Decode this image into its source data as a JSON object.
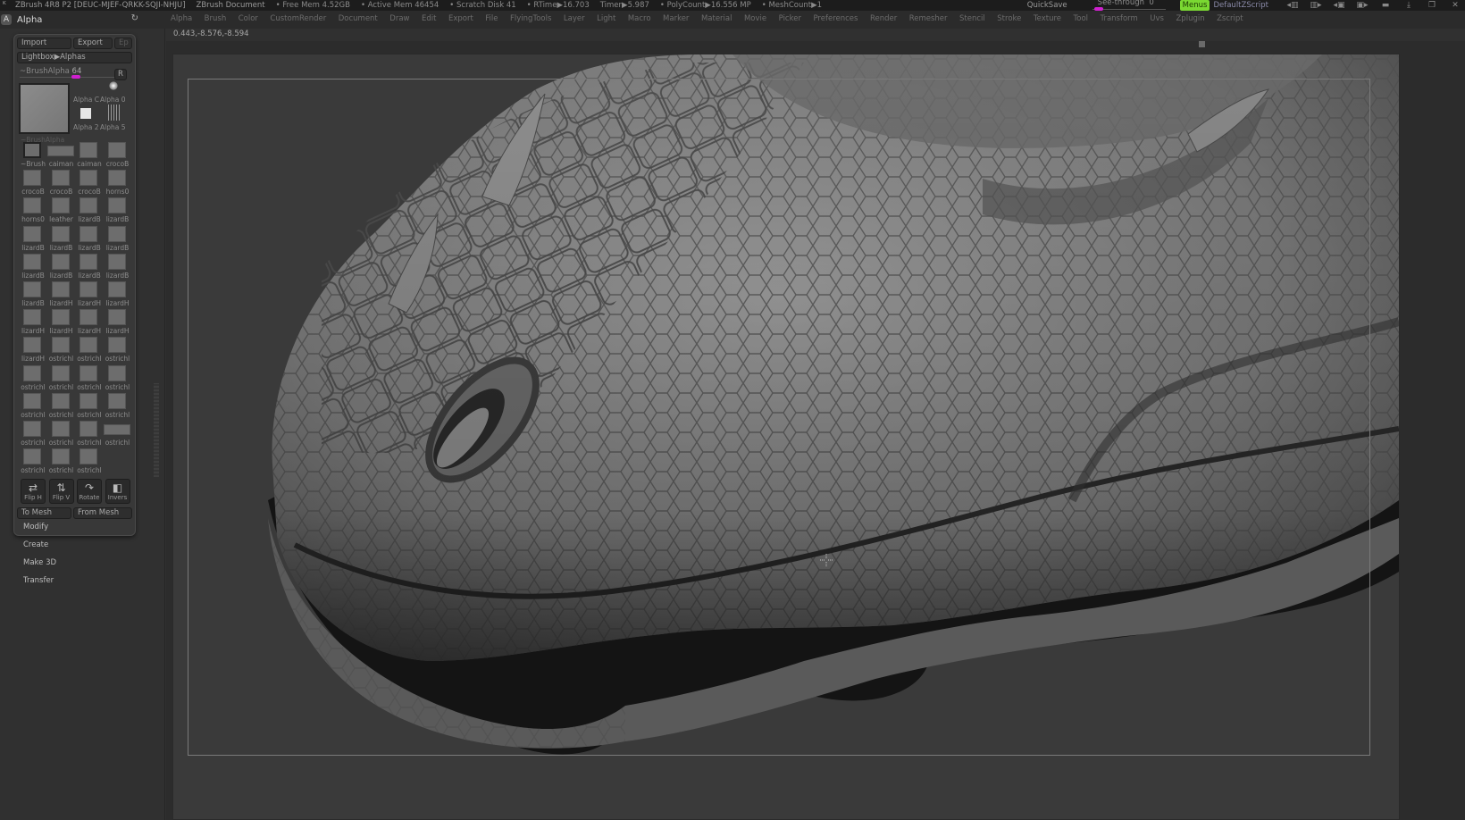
{
  "titlebar": {
    "app_title": "ZBrush 4R8 P2 [DEUC-MJEF-QRKK-SQJI-NHJU]",
    "document": "ZBrush Document",
    "free_mem": "• Free Mem 4.52GB",
    "active_mem": "• Active Mem 46454",
    "scratch_disk": "• Scratch Disk 41",
    "rtime": "• RTime▶16.703",
    "timer": "Timer▶5.987",
    "polycount": "• PolyCount▶16.556 MP",
    "meshcount": "• MeshCount▶1",
    "quicksave": "QuickSave",
    "see_through_label": "See-through",
    "see_through_value": "0",
    "see_through_fraction": 0,
    "menus_button": "Menus",
    "default_zscript": "DefaultZScript",
    "accent_color": "#7ad832",
    "slider_color": "#d020d0"
  },
  "palette": {
    "badge": "A",
    "title": "Alpha"
  },
  "menubar": {
    "items": [
      "Alpha",
      "Brush",
      "Color",
      "CustomRender",
      "Document",
      "Draw",
      "Edit",
      "Export",
      "File",
      "FlyingTools",
      "Layer",
      "Light",
      "Macro",
      "Marker",
      "Material",
      "Movie",
      "Picker",
      "Preferences",
      "Render",
      "Remesher",
      "Stencil",
      "Stroke",
      "Texture",
      "Tool",
      "Transform",
      "Uvs",
      "Zplugin",
      "Zscript"
    ]
  },
  "coords": "0.443,-8.576,-8.594",
  "alpha_panel": {
    "import": "Import",
    "export": "Export",
    "ep": "Ep",
    "lightbox": "Lightbox▶Alphas",
    "brush_alpha_label": "~BrushAlpha",
    "brush_alpha_value": "64",
    "r_button": "R",
    "big_thumb_label": "~BrushAlpha",
    "mini": [
      "Alpha C",
      "Alpha 0",
      "Alpha 2",
      "Alpha 5"
    ],
    "grid": [
      "~Brush",
      "caiman",
      "caiman",
      "crocoB",
      "crocoB",
      "crocoB",
      "crocoB",
      "horns0",
      "horns0",
      "leather",
      "lizardB",
      "lizardB",
      "lizardB",
      "lizardB",
      "lizardB",
      "lizardB",
      "lizardB",
      "lizardB",
      "lizardB",
      "lizardB",
      "lizardB",
      "lizardH",
      "lizardH",
      "lizardH",
      "lizardH",
      "lizardH",
      "lizardH",
      "lizardH",
      "lizardH",
      "ostrichl",
      "ostrichl",
      "ostrichl",
      "ostrichl",
      "ostrichl",
      "ostrichl",
      "ostrichl",
      "ostrichl",
      "ostrichl",
      "ostrichl",
      "ostrichl",
      "ostrichl",
      "ostrichl",
      "ostrichl",
      "ostrichl",
      "ostrichl",
      "ostrichl",
      "ostrichl"
    ],
    "tools": [
      {
        "label": "Flip H",
        "icon": "⇄"
      },
      {
        "label": "Flip V",
        "icon": "⇅"
      },
      {
        "label": "Rotate",
        "icon": "↷"
      },
      {
        "label": "Invers",
        "icon": "◧"
      }
    ],
    "to_mesh": "To Mesh",
    "from_mesh": "From Mesh"
  },
  "submenus": [
    "Modify",
    "Create",
    "Make 3D",
    "Transfer"
  ]
}
